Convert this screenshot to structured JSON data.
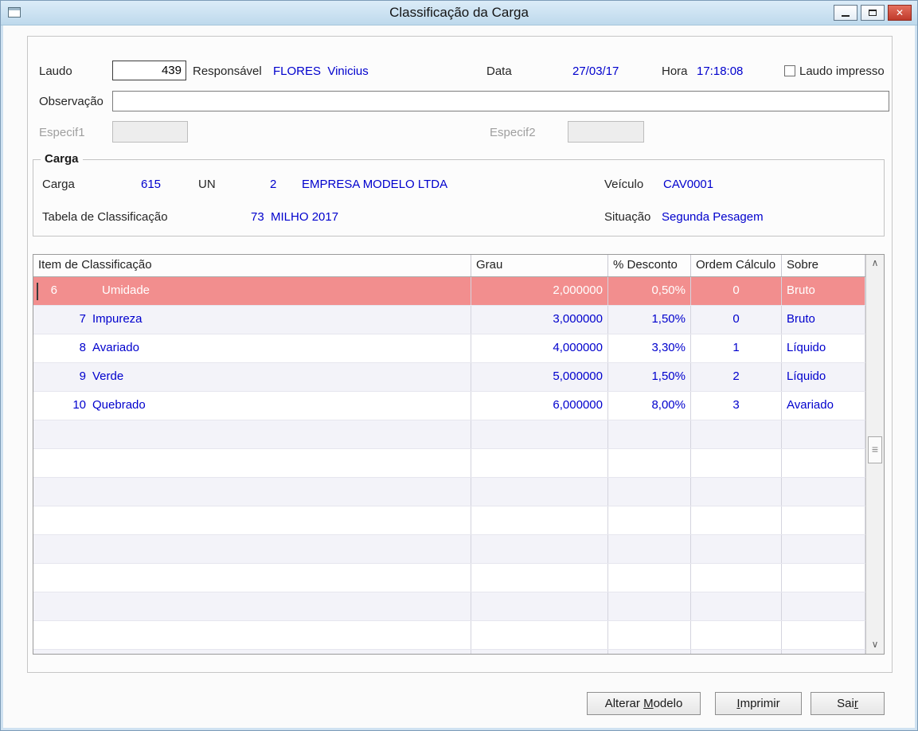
{
  "window": {
    "title": "Classificação da Carga"
  },
  "icons": {
    "close": "✕",
    "scroll_up": "∧",
    "scroll_down": "∨",
    "thumb_grip": "≡"
  },
  "colors": {
    "value_text": "#0000cd",
    "selected_row": "#f28e8e",
    "titlebar": "#c6ddef",
    "close_button": "#c0392b"
  },
  "form": {
    "laudo_label": "Laudo",
    "laudo_value": "439",
    "responsavel_label": "Responsável",
    "responsavel_value": "FLORES  Vinicius",
    "data_label": "Data",
    "data_value": "27/03/17",
    "hora_label": "Hora",
    "hora_value": "17:18:08",
    "laudo_impresso_label": "Laudo impresso",
    "observacao_label": "Observação",
    "observacao_value": "",
    "especif1_label": "Especif1",
    "especif1_value": "",
    "especif2_label": "Especif2",
    "especif2_value": ""
  },
  "carga": {
    "group_title": "Carga",
    "carga_label": "Carga",
    "carga_value": "615",
    "un_label": "UN",
    "un_value": "2",
    "empresa": "EMPRESA MODELO LTDA",
    "veiculo_label": "Veículo",
    "veiculo_value": "CAV0001",
    "tabela_label": "Tabela de Classificação",
    "tabela_value": "73  MILHO 2017",
    "situacao_label": "Situação",
    "situacao_value": "Segunda Pesagem"
  },
  "grid": {
    "columns": [
      "Item de Classificação",
      "Grau",
      "% Desconto",
      "Ordem Cálculo",
      "Sobre"
    ],
    "rows": [
      {
        "num": "6",
        "name": "Umidade",
        "grau": "2,000000",
        "desconto": "0,50%",
        "ordem": "0",
        "sobre": "Bruto",
        "selected": true
      },
      {
        "num": "7",
        "name": "Impureza",
        "grau": "3,000000",
        "desconto": "1,50%",
        "ordem": "0",
        "sobre": "Bruto",
        "selected": false
      },
      {
        "num": "8",
        "name": "Avariado",
        "grau": "4,000000",
        "desconto": "3,30%",
        "ordem": "1",
        "sobre": "Líquido",
        "selected": false
      },
      {
        "num": "9",
        "name": "Verde",
        "grau": "5,000000",
        "desconto": "1,50%",
        "ordem": "2",
        "sobre": "Líquido",
        "selected": false
      },
      {
        "num": "10",
        "name": "Quebrado",
        "grau": "6,000000",
        "desconto": "8,00%",
        "ordem": "3",
        "sobre": "Avariado",
        "selected": false
      }
    ],
    "empty_row_count": 9
  },
  "buttons": [
    {
      "label": "Alterar Modelo",
      "accel": "M"
    },
    {
      "label": "Imprimir",
      "accel": "I"
    },
    {
      "label": "Sair",
      "accel": "r"
    }
  ]
}
